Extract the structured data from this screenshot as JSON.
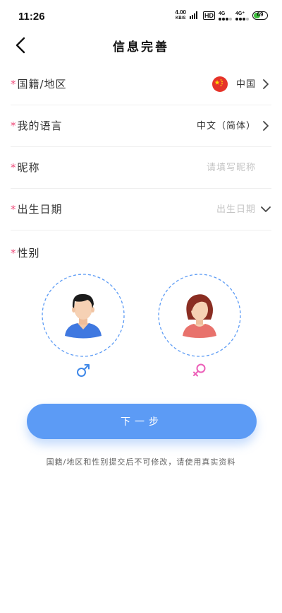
{
  "status_bar": {
    "time": "11:26",
    "net_speed": "4.00",
    "net_speed_unit": "KB/S",
    "hd": "HD",
    "cell1": "4G",
    "cell2": "4G⁺",
    "battery": "69"
  },
  "header": {
    "title": "信息完善",
    "back_icon": "chevron-left-icon"
  },
  "form": {
    "required_mark": "*",
    "region": {
      "label": "国籍/地区",
      "value": "中国"
    },
    "language": {
      "label": "我的语言",
      "value": "中文（简体）"
    },
    "nickname": {
      "label": "昵称",
      "placeholder": "请填写昵称"
    },
    "birthday": {
      "label": "出生日期",
      "placeholder": "出生日期"
    },
    "gender": {
      "label": "性别",
      "male_symbol": "♂",
      "female_symbol": "♀"
    }
  },
  "next_button": "下一步",
  "notice": "国籍/地区和性别提交后不可修改，请使用真实资料",
  "colors": {
    "accent": "#5c9bf5",
    "required": "#ef4b7a",
    "male": "#3f88e8",
    "female": "#ec5fb8"
  }
}
